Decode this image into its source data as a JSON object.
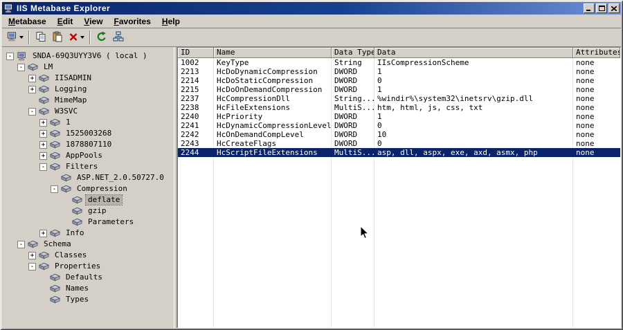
{
  "window": {
    "title": "IIS Metabase Explorer"
  },
  "colors": {
    "chrome": "#d4d0c8",
    "titlebar_start": "#0a246a",
    "titlebar_end": "#6f8fd8",
    "selection": "#0a246a",
    "selection_text": "#ffffff",
    "tree_selection": "#b7b4aa",
    "delete_red": "#c00000",
    "refresh_green": "#1a7a1a"
  },
  "menu": {
    "items": [
      {
        "first": "M",
        "rest": "etabase"
      },
      {
        "first": "E",
        "rest": "dit"
      },
      {
        "first": "V",
        "rest": "iew"
      },
      {
        "first": "F",
        "rest": "avorites"
      },
      {
        "first": "H",
        "rest": "elp"
      }
    ]
  },
  "toolbar": {
    "buttons": [
      {
        "name": "connect",
        "icon": "computer-icon",
        "has_dropdown": true
      },
      {
        "name": "copy",
        "icon": "copy-icon"
      },
      {
        "name": "paste",
        "icon": "paste-icon"
      },
      {
        "name": "delete",
        "icon": "delete-x-icon",
        "has_dropdown": true,
        "color": "#c00000"
      },
      {
        "name": "refresh",
        "icon": "refresh-icon",
        "color": "#1a7a1a"
      },
      {
        "name": "network",
        "icon": "network-icon"
      }
    ]
  },
  "tree": {
    "items": [
      {
        "label": "SNDA-69Q3UYY3V6 ( local )",
        "level": 0,
        "expand": "-",
        "icon": "computer",
        "selected": false
      },
      {
        "label": "LM",
        "level": 1,
        "expand": "-",
        "icon": "db",
        "selected": false
      },
      {
        "label": "IISADMIN",
        "level": 2,
        "expand": "+",
        "icon": "db",
        "selected": false
      },
      {
        "label": "Logging",
        "level": 2,
        "expand": "+",
        "icon": "db",
        "selected": false
      },
      {
        "label": "MimeMap",
        "level": 2,
        "expand": "",
        "icon": "db",
        "selected": false
      },
      {
        "label": "W3SVC",
        "level": 2,
        "expand": "-",
        "icon": "db",
        "selected": false
      },
      {
        "label": "1",
        "level": 3,
        "expand": "+",
        "icon": "db",
        "selected": false
      },
      {
        "label": "1525003268",
        "level": 3,
        "expand": "+",
        "icon": "db",
        "selected": false
      },
      {
        "label": "1878807110",
        "level": 3,
        "expand": "+",
        "icon": "db",
        "selected": false
      },
      {
        "label": "AppPools",
        "level": 3,
        "expand": "+",
        "icon": "db",
        "selected": false
      },
      {
        "label": "Filters",
        "level": 3,
        "expand": "-",
        "icon": "db",
        "selected": false
      },
      {
        "label": "ASP.NET_2.0.50727.0",
        "level": 4,
        "expand": "",
        "icon": "db",
        "selected": false
      },
      {
        "label": "Compression",
        "level": 4,
        "expand": "-",
        "icon": "db",
        "selected": false
      },
      {
        "label": "deflate",
        "level": 5,
        "expand": "",
        "icon": "db",
        "selected": true
      },
      {
        "label": "gzip",
        "level": 5,
        "expand": "",
        "icon": "db",
        "selected": false
      },
      {
        "label": "Parameters",
        "level": 5,
        "expand": "",
        "icon": "db",
        "selected": false
      },
      {
        "label": "Info",
        "level": 3,
        "expand": "+",
        "icon": "db",
        "selected": false
      },
      {
        "label": "Schema",
        "level": 1,
        "expand": "-",
        "icon": "db",
        "selected": false
      },
      {
        "label": "Classes",
        "level": 2,
        "expand": "+",
        "icon": "db",
        "selected": false
      },
      {
        "label": "Properties",
        "level": 2,
        "expand": "-",
        "icon": "db",
        "selected": false
      },
      {
        "label": "Defaults",
        "level": 3,
        "expand": "",
        "icon": "db",
        "selected": false
      },
      {
        "label": "Names",
        "level": 3,
        "expand": "",
        "icon": "db",
        "selected": false
      },
      {
        "label": "Types",
        "level": 3,
        "expand": "",
        "icon": "db",
        "selected": false
      }
    ]
  },
  "table": {
    "columns": [
      "ID",
      "Name",
      "Data Type",
      "Data",
      "Attributes"
    ],
    "rows": [
      {
        "id": "1002",
        "name": "KeyType",
        "type": "String",
        "data": "IIsCompressionScheme",
        "attr": "none",
        "selected": false
      },
      {
        "id": "2213",
        "name": "HcDoDynamicCompression",
        "type": "DWORD",
        "data": "1",
        "attr": "none",
        "selected": false
      },
      {
        "id": "2214",
        "name": "HcDoStaticCompression",
        "type": "DWORD",
        "data": "0",
        "attr": "none",
        "selected": false
      },
      {
        "id": "2215",
        "name": "HcDoOnDemandCompression",
        "type": "DWORD",
        "data": "1",
        "attr": "none",
        "selected": false
      },
      {
        "id": "2237",
        "name": "HcCompressionDll",
        "type": "String...",
        "data": "%windir%\\system32\\inetsrv\\gzip.dll",
        "attr": "none",
        "selected": false
      },
      {
        "id": "2238",
        "name": "HcFileExtensions",
        "type": "MultiS...",
        "data": "htm, html, js, css, txt",
        "attr": "none",
        "selected": false
      },
      {
        "id": "2240",
        "name": "HcPriority",
        "type": "DWORD",
        "data": "1",
        "attr": "none",
        "selected": false
      },
      {
        "id": "2241",
        "name": "HcDynamicCompressionLevel",
        "type": "DWORD",
        "data": "0",
        "attr": "none",
        "selected": false
      },
      {
        "id": "2242",
        "name": "HcOnDemandCompLevel",
        "type": "DWORD",
        "data": "10",
        "attr": "none",
        "selected": false
      },
      {
        "id": "2243",
        "name": "HcCreateFlags",
        "type": "DWORD",
        "data": "0",
        "attr": "none",
        "selected": false
      },
      {
        "id": "2244",
        "name": "HcScriptFileExtensions",
        "type": "MultiS...",
        "data": "asp, dll, aspx, exe, axd, asmx, php",
        "attr": "none",
        "selected": true
      }
    ]
  }
}
